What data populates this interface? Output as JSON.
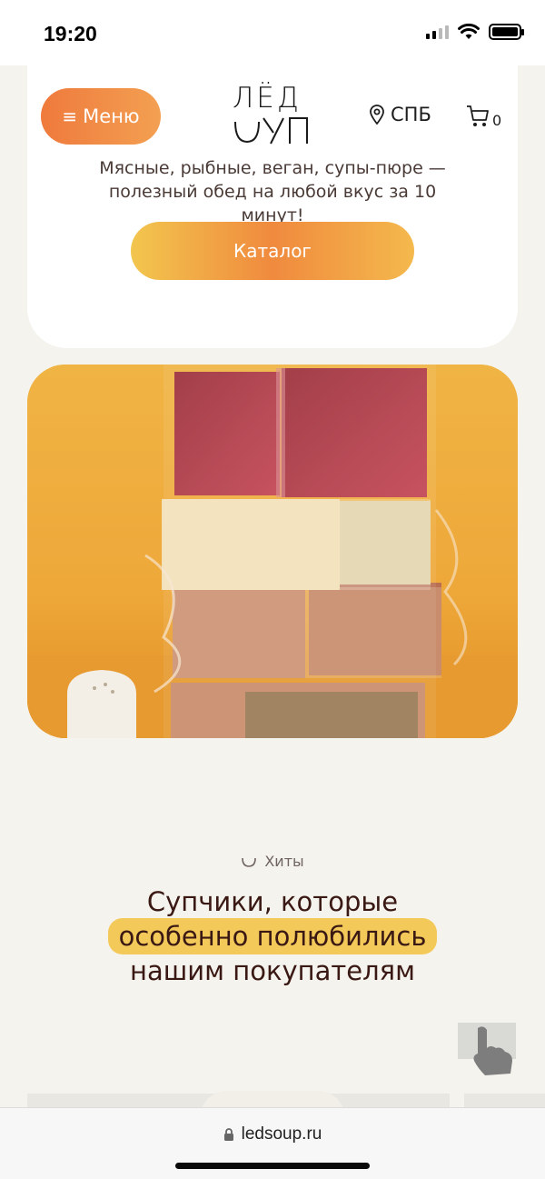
{
  "status_bar": {
    "time": "19:20",
    "icons": [
      "signal-icon",
      "wifi-icon",
      "battery-icon"
    ]
  },
  "header": {
    "menu_label": "Меню",
    "logo_line1": "ЛЁД",
    "logo_line2": "ƲУП",
    "city": "СПБ",
    "cart_count": "0"
  },
  "hero": {
    "tagline": "Мясные, рыбные, веган, супы-пюре — полезный обед на любой вкус за 10 минут!",
    "catalog_button": "Каталог"
  },
  "hits": {
    "label": "Хиты",
    "title_line1": "Супчики, которые",
    "title_highlight": "особенно полюбились",
    "title_line3": "нашим покупателям"
  },
  "browser": {
    "url": "ledsoup.ru"
  },
  "colors": {
    "page_bg": "#f4f3ee",
    "accent_orange": "#ef7a3c",
    "accent_yellow": "#f3c95a",
    "title_color": "#3a1813"
  }
}
